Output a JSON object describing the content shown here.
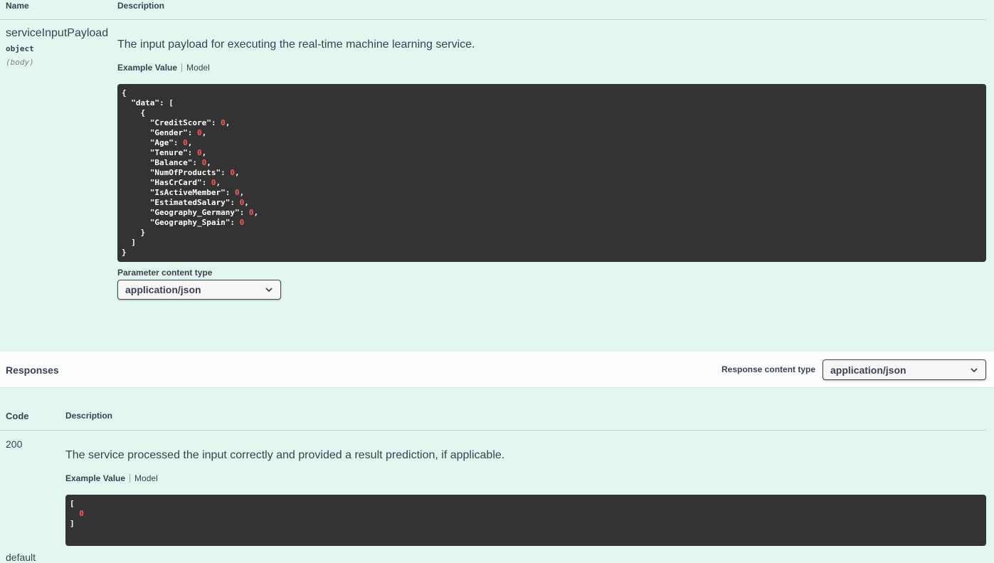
{
  "parameters": {
    "col_name": "Name",
    "col_description": "Description",
    "param": {
      "name": "serviceInputPayload",
      "type": "object",
      "in": "(body)",
      "description": "The input payload for executing the real-time machine learning service.",
      "tab_example": "Example Value",
      "tab_model": "Model",
      "example_fields": [
        {
          "key": "CreditScore",
          "value": "0"
        },
        {
          "key": "Gender",
          "value": "0"
        },
        {
          "key": "Age",
          "value": "0"
        },
        {
          "key": "Tenure",
          "value": "0"
        },
        {
          "key": "Balance",
          "value": "0"
        },
        {
          "key": "NumOfProducts",
          "value": "0"
        },
        {
          "key": "HasCrCard",
          "value": "0"
        },
        {
          "key": "IsActiveMember",
          "value": "0"
        },
        {
          "key": "EstimatedSalary",
          "value": "0"
        },
        {
          "key": "Geography_Germany",
          "value": "0"
        },
        {
          "key": "Geography_Spain",
          "value": "0"
        }
      ],
      "content_type_label": "Parameter content type",
      "content_type_value": "application/json"
    }
  },
  "responses": {
    "title": "Responses",
    "content_type_label": "Response content type",
    "content_type_value": "application/json",
    "col_code": "Code",
    "col_description": "Description",
    "items": [
      {
        "code": "200",
        "description": "The service processed the input correctly and provided a result prediction, if applicable.",
        "tab_example": "Example Value",
        "tab_model": "Model",
        "example_value": "0"
      }
    ],
    "next_code_partial": "default"
  }
}
